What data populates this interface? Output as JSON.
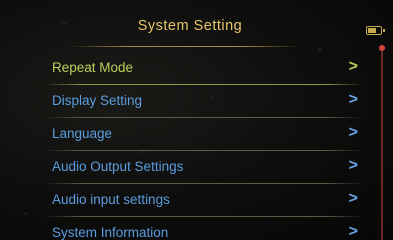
{
  "header": {
    "title": "System  Setting"
  },
  "status": {
    "battery_icon": "battery-icon",
    "battery_level": 0.7
  },
  "menu": {
    "items": [
      {
        "label": "Repeat Mode",
        "selected": true
      },
      {
        "label": "Display Setting",
        "selected": false
      },
      {
        "label": "Language",
        "selected": false
      },
      {
        "label": "Audio Output Settings",
        "selected": false
      },
      {
        "label": "Audio input settings",
        "selected": false
      },
      {
        "label": "System Information",
        "selected": false
      }
    ],
    "chevron": ">"
  },
  "colors": {
    "title": "#e8c56a",
    "item_text": "#5b9de0",
    "selected_text": "#b9d25c",
    "scroll_thumb": "#d2463a"
  }
}
